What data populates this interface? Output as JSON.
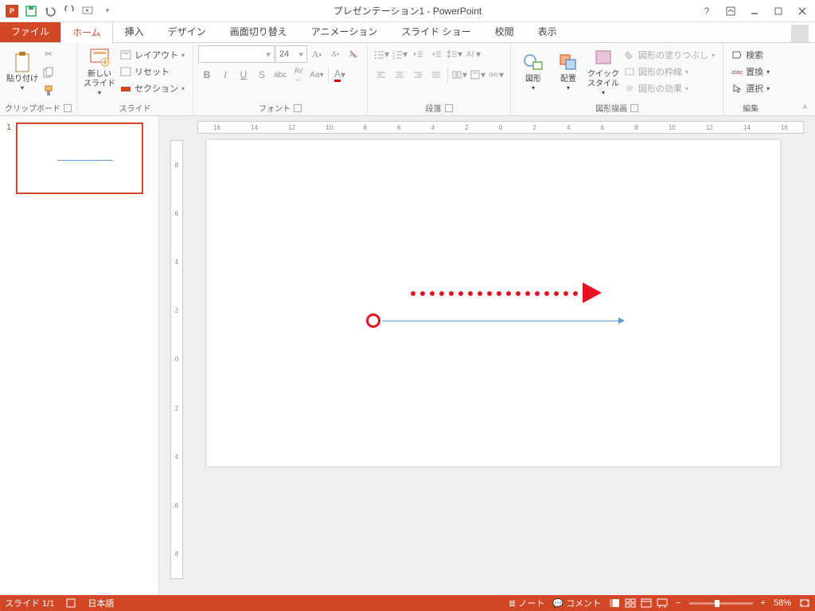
{
  "title": "プレゼンテーション1 - PowerPoint",
  "tabs": {
    "file": "ファイル",
    "home": "ホーム",
    "insert": "挿入",
    "design": "デザイン",
    "transitions": "画面切り替え",
    "animations": "アニメーション",
    "slideshow": "スライド ショー",
    "review": "校閲",
    "view": "表示"
  },
  "ribbon": {
    "clipboard": {
      "label": "クリップボード",
      "paste": "貼り付け"
    },
    "slides": {
      "label": "スライド",
      "new": "新しい\nスライド",
      "layout": "レイアウト",
      "reset": "リセット",
      "section": "セクション"
    },
    "font": {
      "label": "フォント",
      "size": "24"
    },
    "paragraph": {
      "label": "段落"
    },
    "drawing": {
      "label": "図形描画",
      "shapes": "図形",
      "arrange": "配置",
      "quick": "クイック\nスタイル",
      "fill": "図形の塗りつぶし",
      "outline": "図形の枠線",
      "effects": "図形の効果"
    },
    "editing": {
      "label": "編集",
      "find": "検索",
      "replace": "置換",
      "select": "選択"
    }
  },
  "thumb": {
    "num": "1"
  },
  "hruler_ticks": [
    "16",
    "14",
    "12",
    "10",
    "8",
    "6",
    "4",
    "2",
    "0",
    "2",
    "4",
    "6",
    "8",
    "10",
    "12",
    "14",
    "16"
  ],
  "vruler_ticks": [
    "8",
    "6",
    "4",
    "2",
    "0",
    "2",
    "4",
    "6",
    "8"
  ],
  "status": {
    "slide": "スライド 1/1",
    "lang": "日本語",
    "notes": "ノート",
    "comments": "コメント",
    "zoom": "58%"
  }
}
